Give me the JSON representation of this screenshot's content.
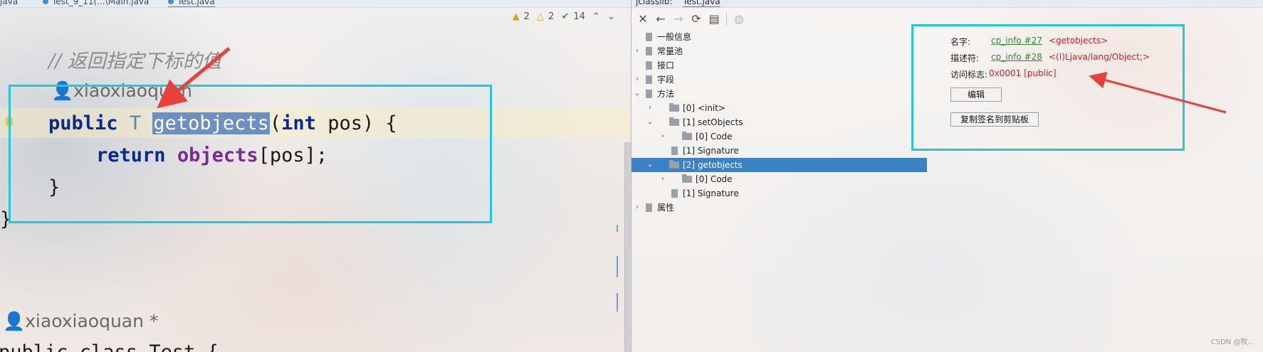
{
  "editor": {
    "tabs": [
      {
        "label": "java"
      },
      {
        "label": "Test_9_11(...\\Main.java"
      },
      {
        "label": "Test.java"
      }
    ],
    "inspections": {
      "warnings_a": "2",
      "warnings_b": "2",
      "ok": "14"
    },
    "lines": {
      "comment": "// 返回指定下标的值",
      "author_hint": "xiaoxiaoquan",
      "public_kw": "public",
      "type_param": "T",
      "method_name": "getobjects",
      "params_open": "(",
      "int_kw": "int",
      "params_rest": " pos) {",
      "return_kw": "return",
      "field": "objects",
      "index": "[pos];",
      "close_brace": "}",
      "outer_brace": "}",
      "author_hint2": "xiaoxiaoquan *",
      "class_decl": "public class Test {"
    }
  },
  "jclasslib": {
    "tab_label": "jclasslib:",
    "tab_file": "Test.java",
    "tree": [
      {
        "label": "一般信息",
        "kind": "doc",
        "level": 0,
        "arrow": ""
      },
      {
        "label": "常量池",
        "kind": "doc",
        "level": 0,
        "arrow": "›"
      },
      {
        "label": "接口",
        "kind": "doc",
        "level": 0,
        "arrow": ""
      },
      {
        "label": "字段",
        "kind": "doc",
        "level": 0,
        "arrow": "›"
      },
      {
        "label": "方法",
        "kind": "doc",
        "level": 0,
        "arrow": "⌄"
      },
      {
        "label": "[0] <init>",
        "kind": "folder",
        "level": 1,
        "arrow": "›"
      },
      {
        "label": "[1] setObjects",
        "kind": "folder",
        "level": 1,
        "arrow": "⌄"
      },
      {
        "label": "[0] Code",
        "kind": "folder",
        "level": 2,
        "arrow": "›"
      },
      {
        "label": "[1] Signature",
        "kind": "doc",
        "level": 2,
        "arrow": ""
      },
      {
        "label": "[2] getobjects",
        "kind": "folder",
        "level": 1,
        "arrow": "⌄",
        "selected": true
      },
      {
        "label": "[0] Code",
        "kind": "folder",
        "level": 2,
        "arrow": "›"
      },
      {
        "label": "[1] Signature",
        "kind": "doc",
        "level": 2,
        "arrow": ""
      },
      {
        "label": "属性",
        "kind": "doc",
        "level": 0,
        "arrow": "›"
      }
    ],
    "detail": {
      "name_label": "名字:",
      "name_link": "cp_info #27",
      "name_value": "<getobjects>",
      "desc_label": "描述符:",
      "desc_link": "cp_info #28",
      "desc_value": "<(I)Ljava/lang/Object;>",
      "access_label": "访问标志:",
      "access_value": "0x0001 [public]",
      "edit_button": "编辑",
      "copy_button": "复制签名到剪贴板"
    },
    "watermark": "CSDN @牧..."
  },
  "colors": {
    "highlight_box": "#26c6da",
    "annotation_arrow": "#e8403a",
    "selection": "#3b82c4"
  }
}
